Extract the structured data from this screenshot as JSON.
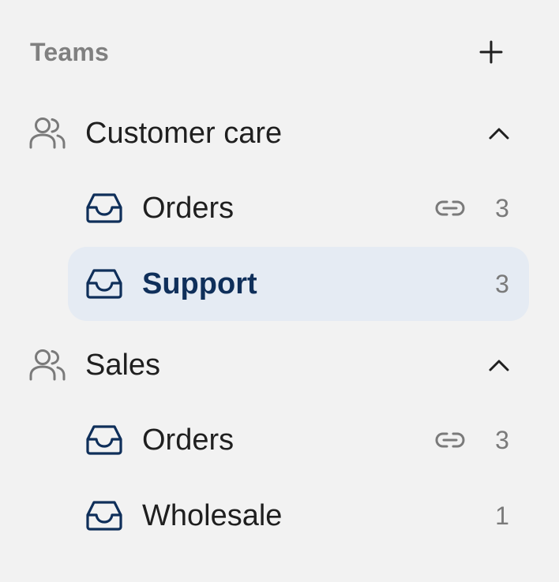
{
  "section": {
    "title": "Teams",
    "add_icon": "plus-icon"
  },
  "teams": [
    {
      "name": "Customer care",
      "icon": "users-icon",
      "expanded": true,
      "inboxes": [
        {
          "name": "Orders",
          "count": "3",
          "linked": true,
          "active": false
        },
        {
          "name": "Support",
          "count": "3",
          "linked": false,
          "active": true
        }
      ]
    },
    {
      "name": "Sales",
      "icon": "users-icon",
      "expanded": true,
      "inboxes": [
        {
          "name": "Orders",
          "count": "3",
          "linked": true,
          "active": false
        },
        {
          "name": "Wholesale",
          "count": "1",
          "linked": false,
          "active": false
        }
      ]
    }
  ],
  "colors": {
    "background": "#f2f2f2",
    "active_bg": "#e5ebf3",
    "inbox_icon": "#0f2f5a",
    "muted": "#7a7a7a",
    "text": "#1f1f1f"
  }
}
